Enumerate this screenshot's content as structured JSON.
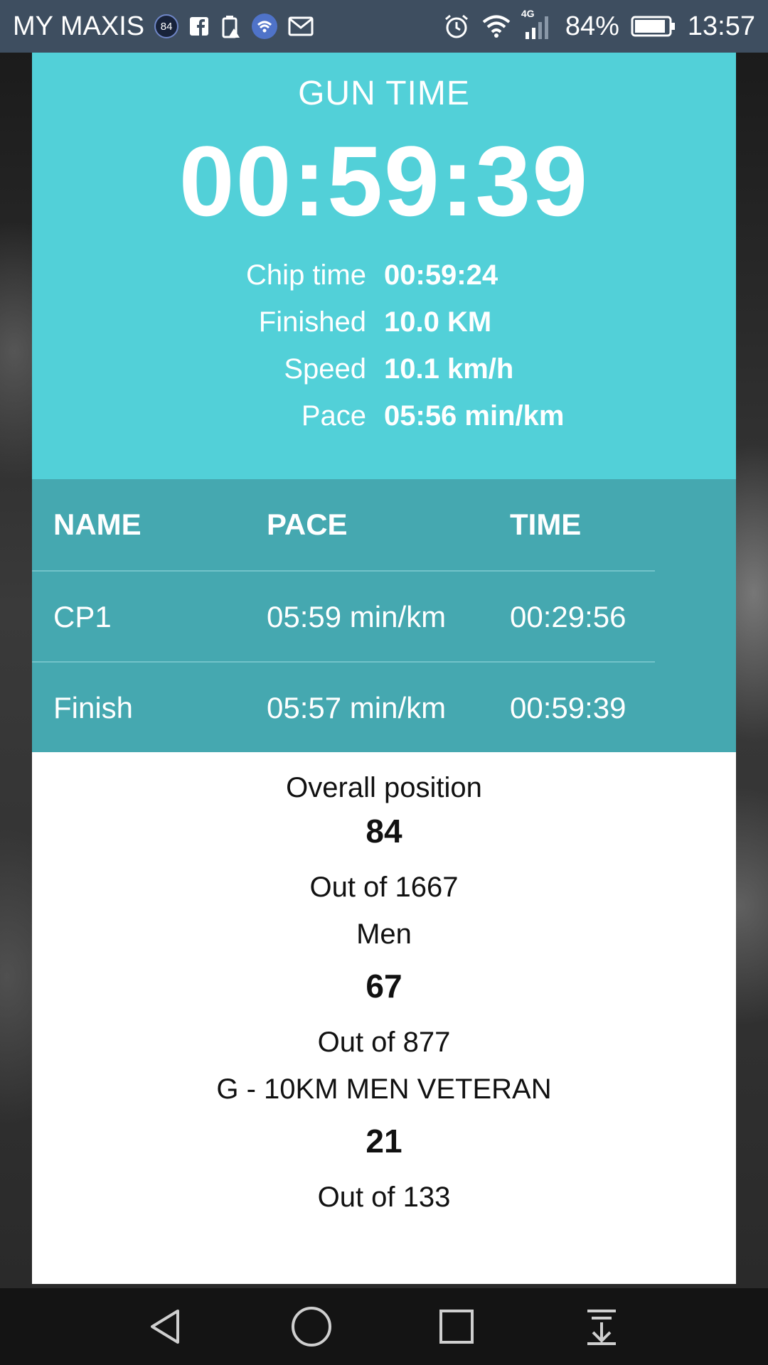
{
  "status_bar": {
    "carrier": "MY MAXIS",
    "badge": "84",
    "network_tag": "4G",
    "battery": "84%",
    "time": "13:57"
  },
  "gun_time": {
    "label": "GUN TIME",
    "value": "00:59:39"
  },
  "stats": [
    {
      "label": "Chip time",
      "value": "00:59:24"
    },
    {
      "label": "Finished",
      "value": "10.0 KM"
    },
    {
      "label": "Speed",
      "value": "10.1 km/h"
    },
    {
      "label": "Pace",
      "value": "05:56 min/km"
    }
  ],
  "splits": {
    "headers": [
      "NAME",
      "PACE",
      "TIME"
    ],
    "rows": [
      [
        "CP1",
        "05:59 min/km",
        "00:29:56"
      ],
      [
        "Finish",
        "05:57 min/km",
        "00:59:39"
      ]
    ]
  },
  "rankings": [
    {
      "label": "Overall position",
      "position": "84",
      "out_of": "Out of 1667"
    },
    {
      "label": "Men",
      "position": "67",
      "out_of": "Out of 877"
    },
    {
      "label": "G - 10KM MEN VETERAN",
      "position": "21",
      "out_of": "Out of 133"
    }
  ],
  "nav_icons": [
    "back-icon",
    "home-icon",
    "recents-icon",
    "notification-pull-icon"
  ]
}
